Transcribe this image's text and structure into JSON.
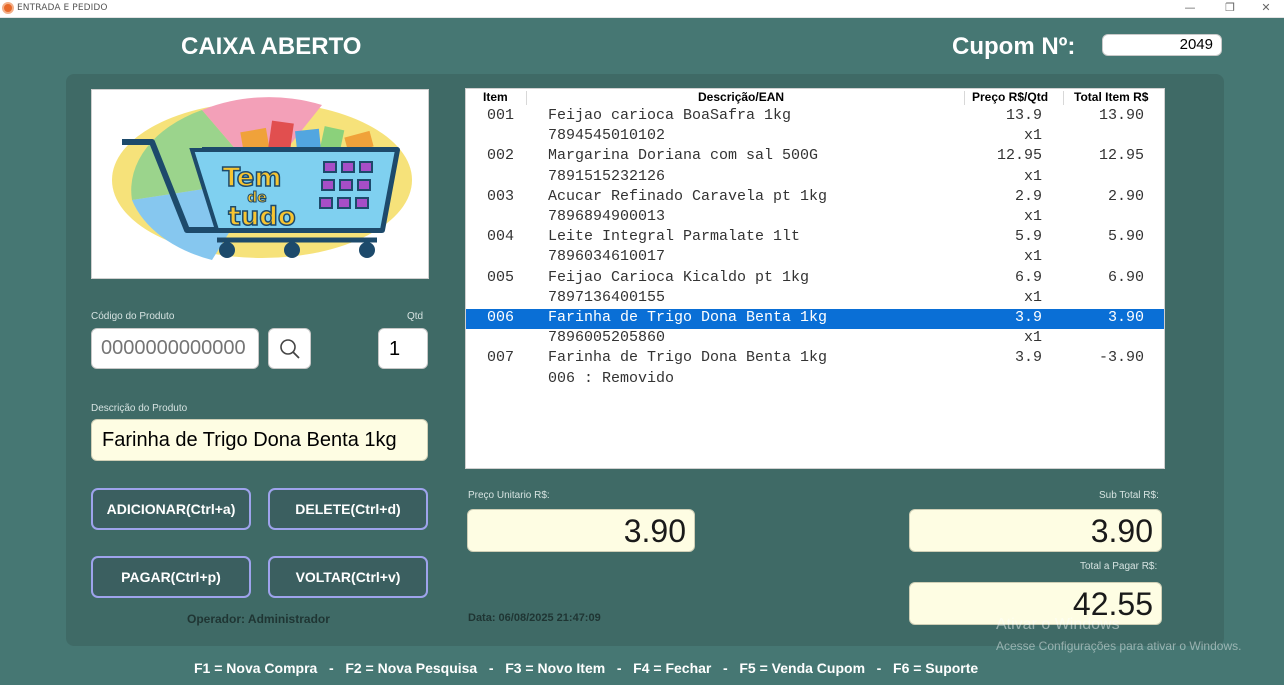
{
  "window": {
    "title": "ENTRADA E PEDIDO",
    "minimize": "—",
    "maximize": "❐",
    "close": "✕"
  },
  "header": {
    "status": "CAIXA ABERTO",
    "cupom_label": "Cupom Nº:",
    "cupom_number": "2049"
  },
  "form": {
    "codigo_label": "Código do Produto",
    "codigo_placeholder": "0000000000000",
    "qtd_label": "Qtd",
    "qtd_value": "1",
    "descricao_label": "Descrição do Produto",
    "descricao_value": "Farinha de Trigo Dona Benta 1kg"
  },
  "buttons": {
    "adicionar": "ADICIONAR(Ctrl+a)",
    "delete": "DELETE(Ctrl+d)",
    "pagar": "PAGAR(Ctrl+p)",
    "voltar": "VOLTAR(Ctrl+v)"
  },
  "operator": "Operador: Administrador",
  "table": {
    "headers": [
      "Item",
      "Descrição/EAN",
      "Preço R$/Qtd",
      "Total Item R$"
    ],
    "rows": [
      {
        "item": "001",
        "desc": "Feijao carioca BoaSafra 1kg",
        "price": "13.9",
        "total": "13.90",
        "selected": false
      },
      {
        "item": "",
        "desc": "7894545010102",
        "price": "x1",
        "total": "",
        "selected": false
      },
      {
        "item": "002",
        "desc": "Margarina Doriana com sal 500G",
        "price": "12.95",
        "total": "12.95",
        "selected": false
      },
      {
        "item": "",
        "desc": "7891515232126",
        "price": "x1",
        "total": "",
        "selected": false
      },
      {
        "item": "003",
        "desc": "Acucar Refinado Caravela pt 1kg",
        "price": "2.9",
        "total": "2.90",
        "selected": false
      },
      {
        "item": "",
        "desc": "7896894900013",
        "price": "x1",
        "total": "",
        "selected": false
      },
      {
        "item": "004",
        "desc": "Leite Integral Parmalate 1lt",
        "price": "5.9",
        "total": "5.90",
        "selected": false
      },
      {
        "item": "",
        "desc": "7896034610017",
        "price": "x1",
        "total": "",
        "selected": false
      },
      {
        "item": "005",
        "desc": "Feijao Carioca Kicaldo pt 1kg",
        "price": "6.9",
        "total": "6.90",
        "selected": false
      },
      {
        "item": "",
        "desc": "7897136400155",
        "price": "x1",
        "total": "",
        "selected": false
      },
      {
        "item": "006",
        "desc": "Farinha de Trigo Dona Benta 1kg",
        "price": "3.9",
        "total": "3.90",
        "selected": true
      },
      {
        "item": "",
        "desc": "7896005205860",
        "price": "x1",
        "total": "",
        "selected": false
      },
      {
        "item": "007",
        "desc": "Farinha de Trigo Dona Benta 1kg",
        "price": "3.9",
        "total": "-3.90",
        "selected": false
      },
      {
        "item": "",
        "desc": "006 : Removido",
        "price": "",
        "total": "",
        "selected": false
      }
    ]
  },
  "totals": {
    "preco_unitario_label": "Preço Unitario R$:",
    "preco_unitario": "3.90",
    "subtotal_label": "Sub Total R$:",
    "subtotal": "3.90",
    "total_pagar_label": "Total a Pagar R$:",
    "total_pagar": "42.55"
  },
  "date": "Data: 06/08/2025 21:47:09",
  "watermark": {
    "title": "Ativar o Windows",
    "subtitle": "Acesse Configurações para ativar o Windows."
  },
  "shortcuts": "F1 = Nova Compra   -   F2 = Nova Pesquisa   -   F3 = Novo Item   -   F4 = Fechar   -   F5 = Venda Cupom   -   F6 = Suporte",
  "logo": {
    "brand_line1": "Tem",
    "brand_line2": "de",
    "brand_line3": "tudo"
  },
  "colors": {
    "background": "#467773",
    "panel": "#3f6a66",
    "selected_row": "#0a6fd6",
    "field_yellow": "#fefde3",
    "button_border": "#9ea3ec"
  }
}
